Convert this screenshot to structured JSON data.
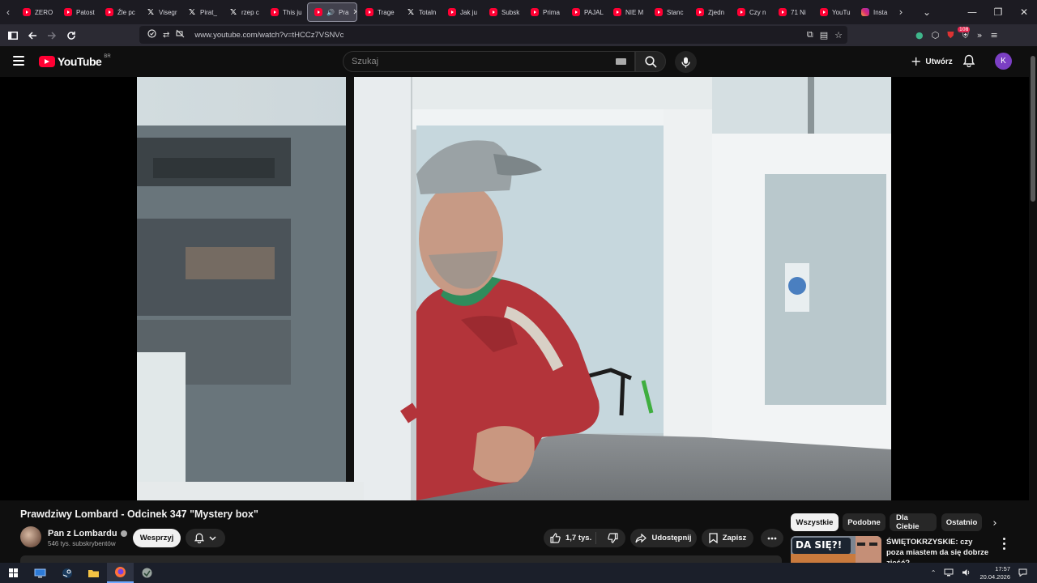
{
  "browser": {
    "tabs": [
      {
        "label": "ZERO",
        "icon": "youtube-icon"
      },
      {
        "label": "Patost",
        "icon": "youtube-icon"
      },
      {
        "label": "Źle pc",
        "icon": "youtube-icon"
      },
      {
        "label": "Visegr",
        "icon": "x-icon"
      },
      {
        "label": "Pirat_",
        "icon": "x-icon"
      },
      {
        "label": "rzep c",
        "icon": "x-icon"
      },
      {
        "label": "This ju",
        "icon": "youtube-icon"
      },
      {
        "label": "Pra",
        "icon": "youtube-icon",
        "active": true
      },
      {
        "label": "Trage",
        "icon": "youtube-icon"
      },
      {
        "label": "Totaln",
        "icon": "x-icon"
      },
      {
        "label": "Jak ju",
        "icon": "youtube-icon"
      },
      {
        "label": "Subsk",
        "icon": "youtube-icon"
      },
      {
        "label": "Prima",
        "icon": "youtube-icon"
      },
      {
        "label": "PAJAL",
        "icon": "youtube-icon"
      },
      {
        "label": "NIE M",
        "icon": "youtube-icon"
      },
      {
        "label": "Stanc",
        "icon": "youtube-icon"
      },
      {
        "label": "Zjedn",
        "icon": "youtube-icon"
      },
      {
        "label": "Czy n",
        "icon": "youtube-icon"
      },
      {
        "label": "71 Ni",
        "icon": "youtube-icon"
      },
      {
        "label": "YouTu",
        "icon": "youtube-icon"
      },
      {
        "label": "Insta",
        "icon": "instagram-icon"
      }
    ],
    "url": "www.youtube.com/watch?v=tHCCz7VSNVc",
    "extension_badge": "108"
  },
  "youtube": {
    "logo_text": "YouTube",
    "country_code": "BR",
    "search_placeholder": "Szukaj",
    "create_label": "Utwórz",
    "avatar_letter": "K",
    "accent_color": "#ff0033"
  },
  "video": {
    "title": "Prawdziwy Lombard - Odcinek 347 \"Mystery box\"",
    "channel_name": "Pan z Lombardu",
    "subscribers": "546 tys. subskrybentów",
    "support_label": "Wesprzyj",
    "likes": "1,7 tys.",
    "share_label": "Udostępnij",
    "save_label": "Zapisz"
  },
  "sidebar": {
    "chips": [
      "Wszystkie",
      "Podobne",
      "Dla Ciebie",
      "Ostatnio"
    ],
    "recommendation": {
      "title": "ŚWIĘTOKRZYSKIE: czy poza miastem da się dobrze zjeść?",
      "thumb_text": "DA SIĘ?!"
    }
  },
  "taskbar": {
    "time": "17:57",
    "date": "20.04.2026"
  }
}
